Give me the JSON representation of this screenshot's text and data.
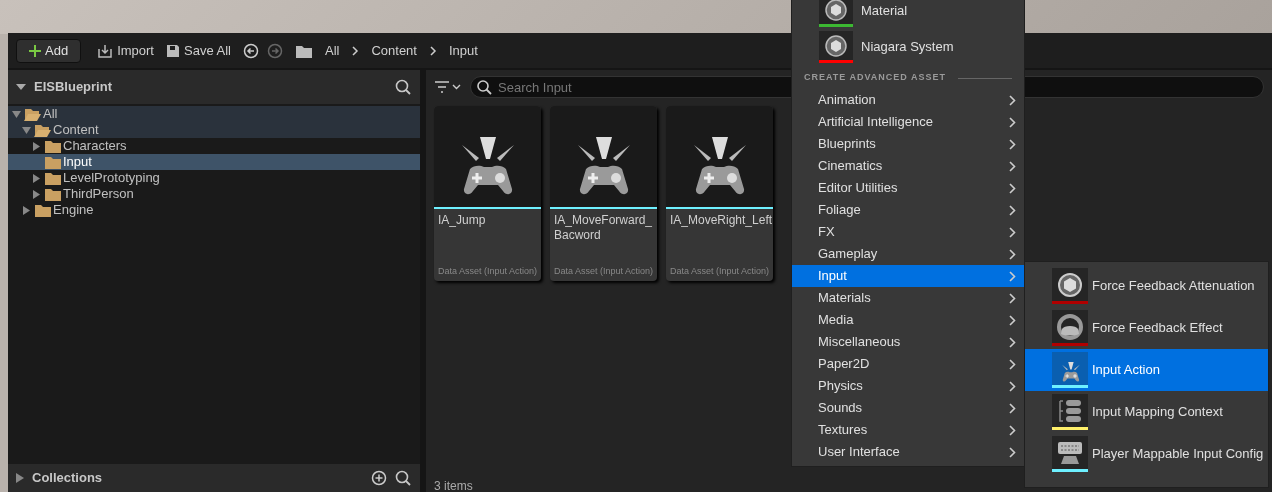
{
  "toolbar": {
    "add": "Add",
    "import": "Import",
    "save_all": "Save All",
    "breadcrumb": [
      "All",
      "Content",
      "Input"
    ]
  },
  "sources": {
    "title": "EISBlueprint",
    "tree": [
      {
        "label": "All",
        "expandable": true,
        "expanded": true,
        "highlighted": true,
        "selected": false,
        "children": [
          {
            "label": "Content",
            "expandable": true,
            "expanded": true,
            "highlighted": true,
            "selected": false,
            "children": [
              {
                "label": "Characters",
                "expandable": true,
                "expanded": false,
                "highlighted": false,
                "selected": false
              },
              {
                "label": "Input",
                "expandable": false,
                "expanded": false,
                "highlighted": false,
                "selected": true
              },
              {
                "label": "LevelPrototyping",
                "expandable": true,
                "expanded": false,
                "highlighted": false,
                "selected": false
              },
              {
                "label": "ThirdPerson",
                "expandable": true,
                "expanded": false,
                "highlighted": false,
                "selected": false
              }
            ]
          },
          {
            "label": "Engine",
            "expandable": true,
            "expanded": false,
            "highlighted": false,
            "selected": false
          }
        ]
      }
    ]
  },
  "collections": {
    "title": "Collections"
  },
  "content": {
    "search": {
      "placeholder": "Search Input"
    },
    "assets": [
      {
        "name": "IA_Jump",
        "type": "Data Asset (Input Action)"
      },
      {
        "name": "IA_MoveForward_\nBacword",
        "type": "Data Asset (Input Action)"
      },
      {
        "name": "IA_MoveRight_Left",
        "type": "Data Asset (Input Action)"
      }
    ],
    "item_count": "3 items"
  },
  "add_menu": {
    "featured": [
      {
        "label": "Material",
        "color": "#3cb832"
      },
      {
        "label": "Niagara System",
        "color": "#ff0000"
      }
    ],
    "section": "CREATE ADVANCED ASSET",
    "categories": [
      {
        "label": "Animation",
        "selected": false
      },
      {
        "label": "Artificial Intelligence",
        "selected": false
      },
      {
        "label": "Blueprints",
        "selected": false
      },
      {
        "label": "Cinematics",
        "selected": false
      },
      {
        "label": "Editor Utilities",
        "selected": false
      },
      {
        "label": "Foliage",
        "selected": false
      },
      {
        "label": "FX",
        "selected": false
      },
      {
        "label": "Gameplay",
        "selected": false
      },
      {
        "label": "Input",
        "selected": true
      },
      {
        "label": "Materials",
        "selected": false
      },
      {
        "label": "Media",
        "selected": false
      },
      {
        "label": "Miscellaneous",
        "selected": false
      },
      {
        "label": "Paper2D",
        "selected": false
      },
      {
        "label": "Physics",
        "selected": false
      },
      {
        "label": "Sounds",
        "selected": false
      },
      {
        "label": "Textures",
        "selected": false
      },
      {
        "label": "User Interface",
        "selected": false
      }
    ],
    "submenu": [
      {
        "label": "Force Feedback Attenuation",
        "kind": "sphere",
        "color": "#b00000",
        "selected": false
      },
      {
        "label": "Force Feedback Effect",
        "kind": "wheel",
        "color": "#b00000",
        "selected": false
      },
      {
        "label": "Input Action",
        "kind": "gamepad",
        "color": "#6ef0ff",
        "selected": true
      },
      {
        "label": "Input Mapping Context",
        "kind": "mapping",
        "color": "#fff06a",
        "selected": false
      },
      {
        "label": "Player Mappable Input Config",
        "kind": "keyboard",
        "color": "#6ef0ff",
        "selected": false
      }
    ]
  }
}
